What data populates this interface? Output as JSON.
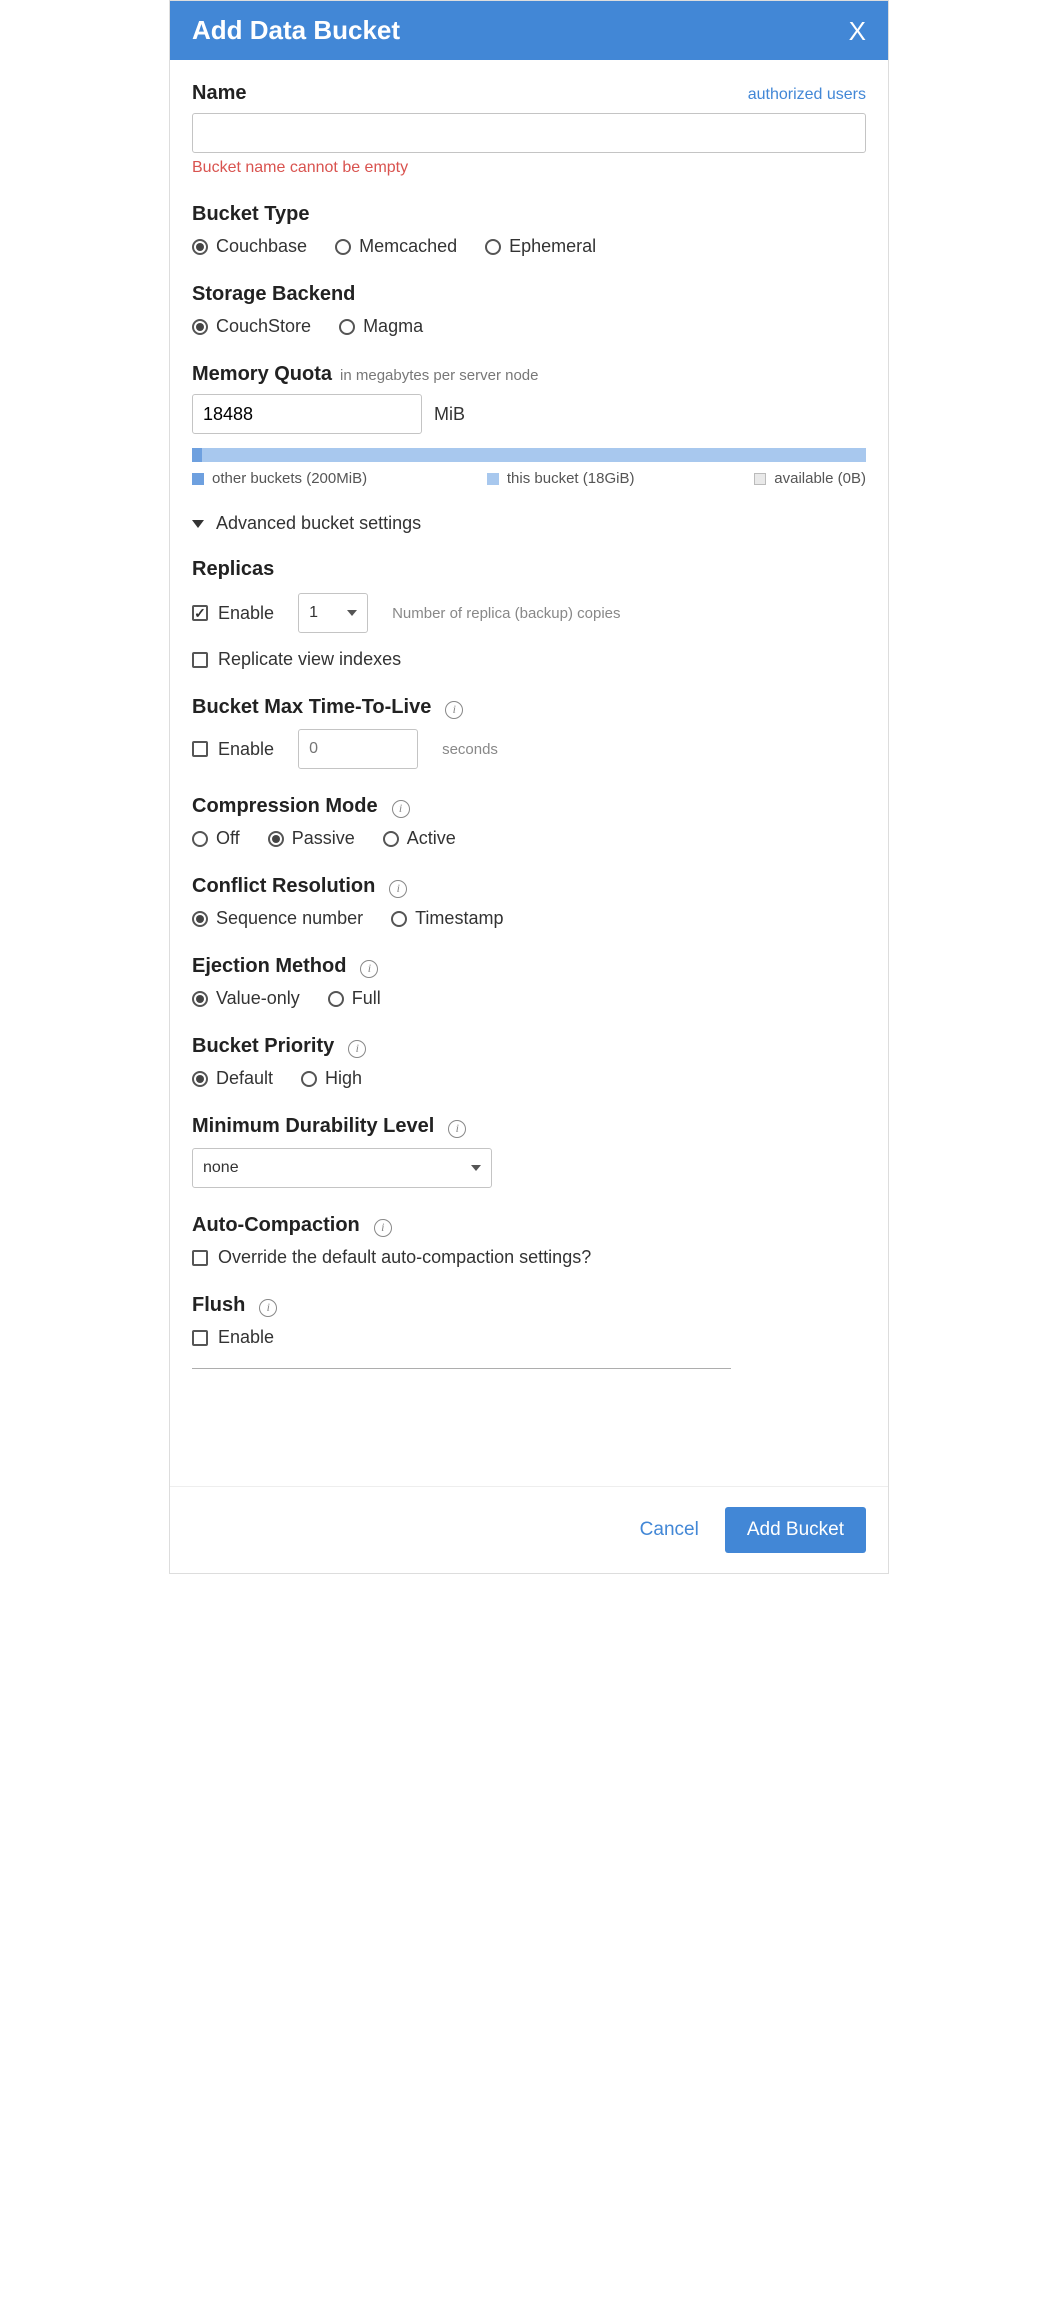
{
  "header": {
    "title": "Add Data Bucket"
  },
  "name": {
    "label": "Name",
    "auth_link": "authorized users",
    "value": "",
    "error": "Bucket name cannot be empty"
  },
  "bucket_type": {
    "label": "Bucket Type",
    "options": [
      "Couchbase",
      "Memcached",
      "Ephemeral"
    ],
    "selected": "Couchbase"
  },
  "storage_backend": {
    "label": "Storage Backend",
    "options": [
      "CouchStore",
      "Magma"
    ],
    "selected": "CouchStore"
  },
  "memory_quota": {
    "label": "Memory Quota",
    "sub": "in megabytes per server node",
    "value": "18488",
    "unit": "MiB",
    "legend": {
      "other": "other buckets (200MiB)",
      "this": "this bucket (18GiB)",
      "avail": "available (0B)"
    }
  },
  "advanced_toggle": "Advanced bucket settings",
  "replicas": {
    "label": "Replicas",
    "enable_label": "Enable",
    "enabled": true,
    "count": "1",
    "hint": "Number of replica (backup) copies",
    "replicate_views_label": "Replicate view indexes",
    "replicate_views": false
  },
  "ttl": {
    "label": "Bucket Max Time-To-Live",
    "enable_label": "Enable",
    "enabled": false,
    "value_placeholder": "0",
    "unit": "seconds"
  },
  "compression": {
    "label": "Compression Mode",
    "options": [
      "Off",
      "Passive",
      "Active"
    ],
    "selected": "Passive"
  },
  "conflict": {
    "label": "Conflict Resolution",
    "options": [
      "Sequence number",
      "Timestamp"
    ],
    "selected": "Sequence number"
  },
  "ejection": {
    "label": "Ejection Method",
    "options": [
      "Value-only",
      "Full"
    ],
    "selected": "Value-only"
  },
  "priority": {
    "label": "Bucket Priority",
    "options": [
      "Default",
      "High"
    ],
    "selected": "Default"
  },
  "durability": {
    "label": "Minimum Durability Level",
    "value": "none"
  },
  "autocompaction": {
    "label": "Auto-Compaction",
    "override_label": "Override the default auto-compaction settings?",
    "override": false
  },
  "flush": {
    "label": "Flush",
    "enable_label": "Enable",
    "enabled": false
  },
  "footer": {
    "cancel": "Cancel",
    "submit": "Add Bucket"
  }
}
